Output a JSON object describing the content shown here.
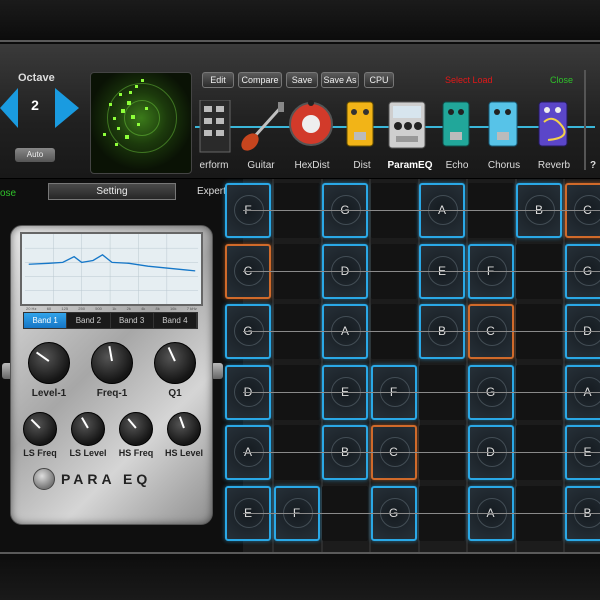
{
  "header": {
    "octave_label": "Octave",
    "octave_value": "2",
    "auto_label": "Auto",
    "buttons": [
      "Edit",
      "Compare",
      "Save",
      "Save As",
      "CPU"
    ],
    "status_text": "Select Load",
    "close_label": "Close",
    "help_label": "?",
    "effects": [
      {
        "label": "erform",
        "icon": "perform-icon"
      },
      {
        "label": "Guitar",
        "icon": "guitar-icon"
      },
      {
        "label": "HexDist",
        "icon": "hexdist-pedal-icon"
      },
      {
        "label": "Dist",
        "icon": "dist-pedal-icon"
      },
      {
        "label": "ParamEQ",
        "icon": "parameq-pedal-icon",
        "selected": true
      },
      {
        "label": "Echo",
        "icon": "echo-pedal-icon"
      },
      {
        "label": "Chorus",
        "icon": "chorus-pedal-icon"
      },
      {
        "label": "Reverb",
        "icon": "reverb-pedal-icon"
      }
    ]
  },
  "panel": {
    "close_label": "ose",
    "setting_label": "Setting",
    "expert_label": "Expert >",
    "graph_axis": [
      "20 Hz",
      "60",
      "125",
      "250",
      "500",
      "1k",
      "2k",
      "4k",
      "8k",
      "16k",
      "7 kHz"
    ],
    "bands": [
      "Band 1",
      "Band 2",
      "Band 3",
      "Band 4"
    ],
    "active_band": 0,
    "knobs_top": [
      "Level-1",
      "Freq-1",
      "Q1"
    ],
    "knobs_bottom": [
      "LS Freq",
      "LS Level",
      "HS Freq",
      "HS Level"
    ],
    "brand": "PARA EQ"
  },
  "fretboard": {
    "rows": [
      [
        "F",
        "",
        "G",
        "",
        "A",
        "",
        "B",
        "C"
      ],
      [
        "C",
        "",
        "D",
        "",
        "E",
        "F",
        "",
        "G"
      ],
      [
        "G",
        "",
        "A",
        "",
        "B",
        "C",
        "",
        "D"
      ],
      [
        "D",
        "",
        "E",
        "F",
        "",
        "G",
        "",
        "A"
      ],
      [
        "A",
        "",
        "B",
        "C",
        "",
        "D",
        "",
        "E"
      ],
      [
        "E",
        "F",
        "",
        "G",
        "",
        "A",
        "",
        "B"
      ]
    ],
    "orange_notes": [
      "C"
    ],
    "colors": {
      "note_border": "#2aa8e6",
      "root_border": "#d06a2a"
    }
  },
  "colors": {
    "accent": "#1a9be0",
    "status_red": "#e21818",
    "close_green": "#2fc12a"
  }
}
